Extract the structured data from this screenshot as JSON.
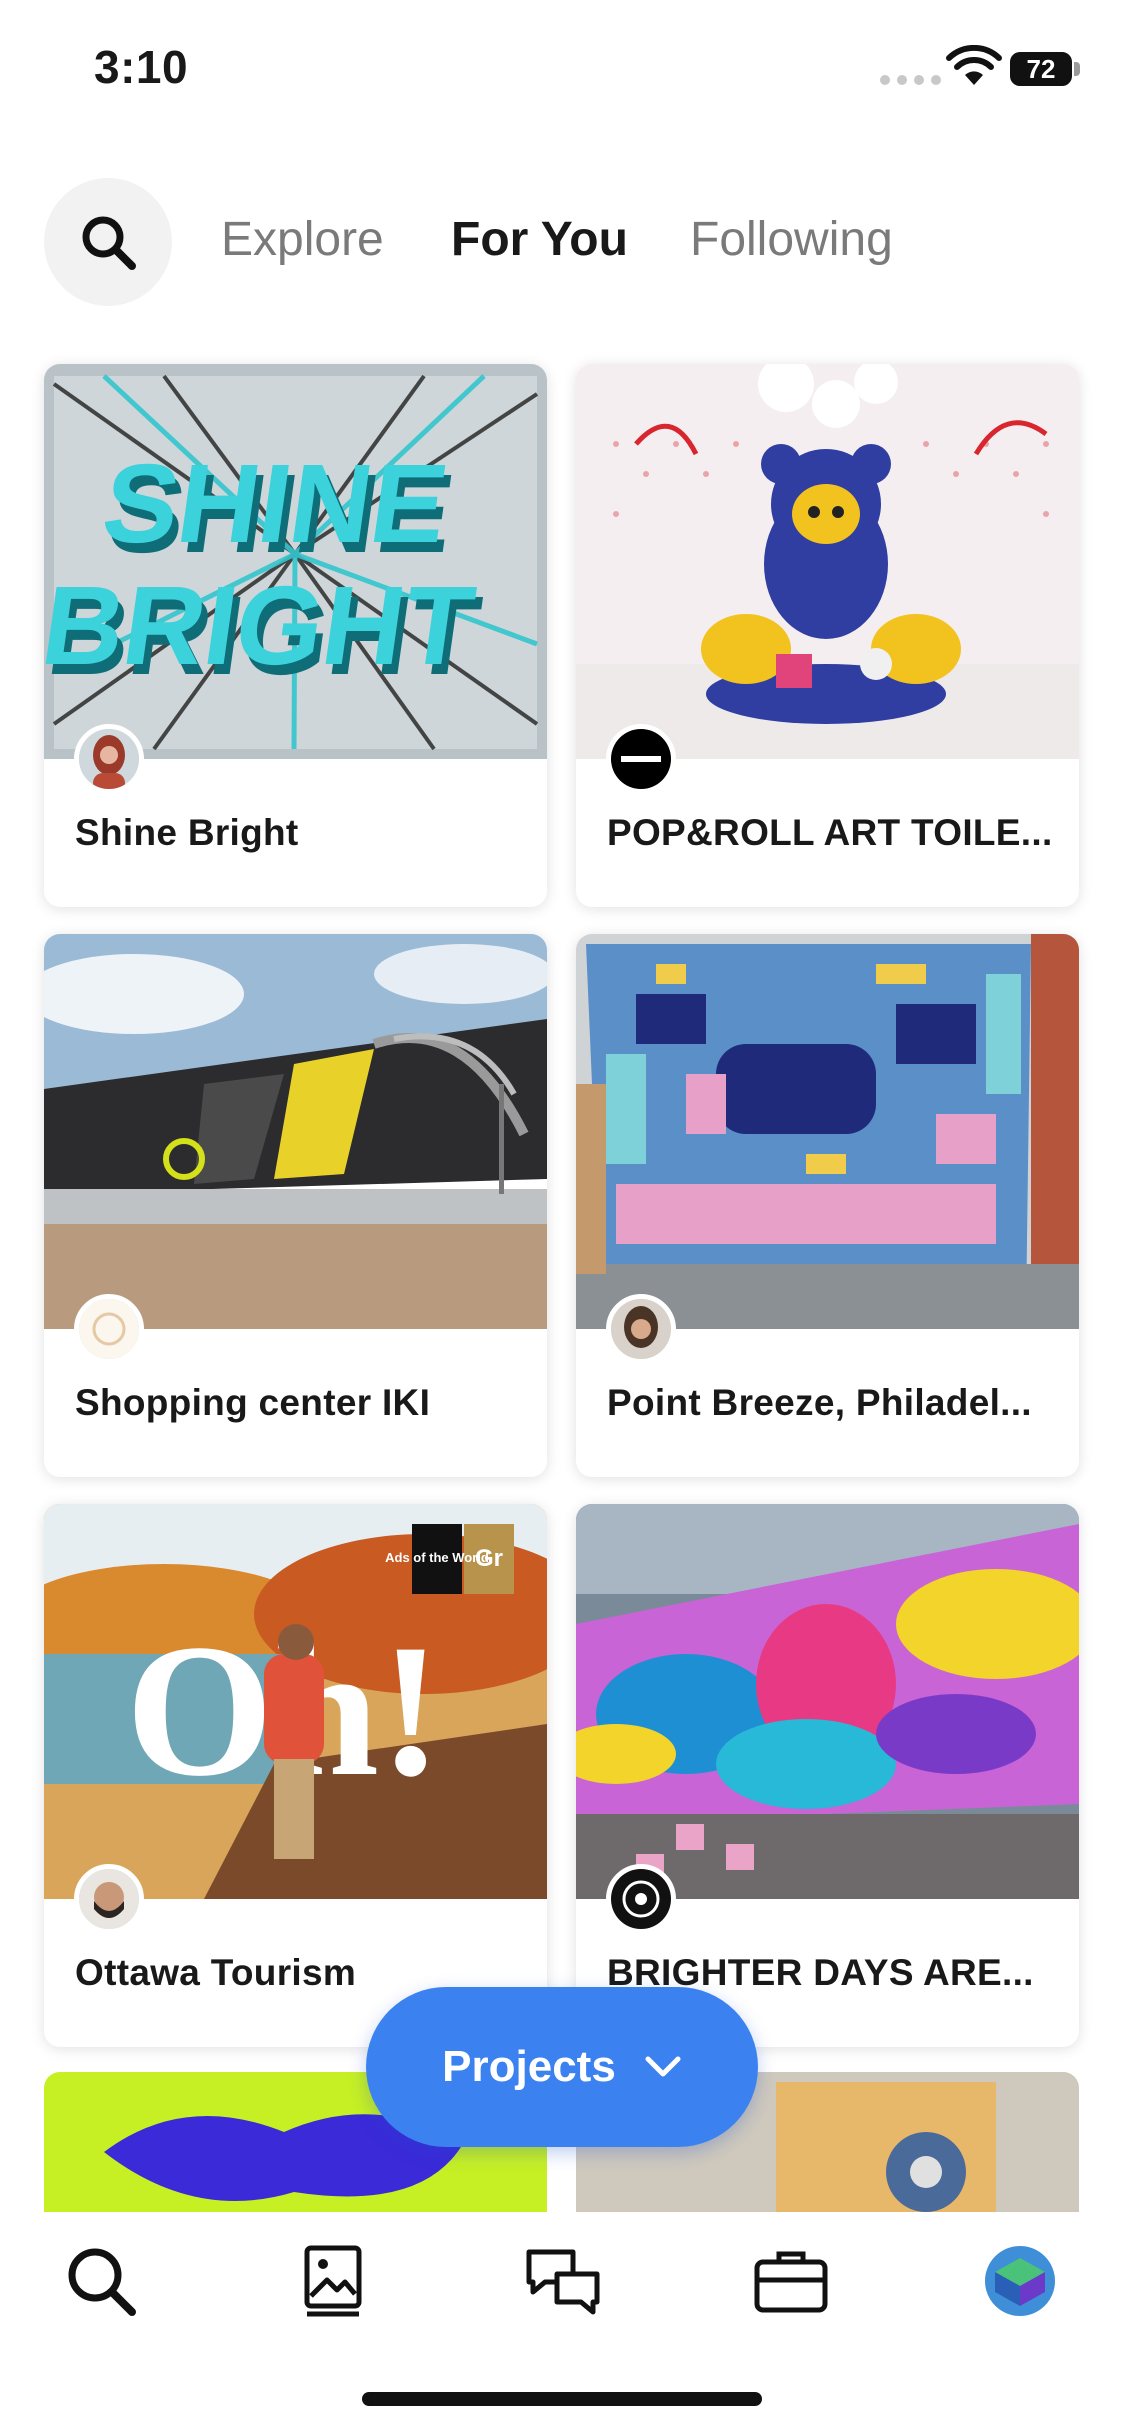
{
  "status_bar": {
    "time": "3:10",
    "battery": "72"
  },
  "nav": {
    "search_icon": "search-icon",
    "tabs": [
      {
        "label": "Explore",
        "active": false
      },
      {
        "label": "For You",
        "active": true
      },
      {
        "label": "Following",
        "active": false
      }
    ]
  },
  "cards": [
    {
      "title": "Shine Bright"
    },
    {
      "title": "POP&ROLL ART TOILE..."
    },
    {
      "title": "Shopping center IKI"
    },
    {
      "title": "Point Breeze, Philadel..."
    },
    {
      "title": "Ottawa Tourism"
    },
    {
      "title": "BRIGHTER DAYS ARE..."
    }
  ],
  "thumb_text": {
    "shine": "SHINE",
    "bright": "BRIGHT",
    "oh": "Oh!",
    "badge_a": "Ads of the World",
    "badge_b": "Gr"
  },
  "fab": {
    "label": "Projects",
    "icon": "chevron-down-icon"
  },
  "tab_bar": {
    "icons": [
      "search-icon",
      "image-gallery-icon",
      "chat-bubbles-icon",
      "briefcase-icon",
      "profile-avatar"
    ]
  },
  "colors": {
    "accent": "#3b82f0",
    "text": "#191919",
    "muted": "#7a7a7a"
  }
}
